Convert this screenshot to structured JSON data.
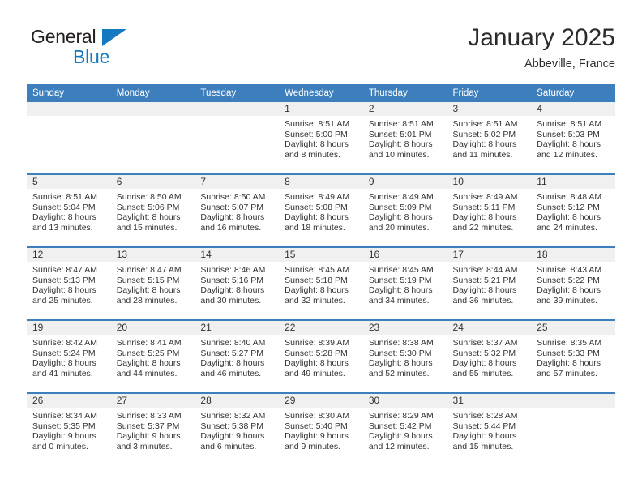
{
  "brand": {
    "name_part1": "General",
    "name_part2": "Blue"
  },
  "header": {
    "month_title": "January 2025",
    "location": "Abbeville, France"
  },
  "colors": {
    "header_blue": "#3d7ebd",
    "brand_blue": "#1579c1",
    "daynum_band": "#f0f0f0",
    "text": "#333333"
  },
  "calendar": {
    "weekday_headers": [
      "Sunday",
      "Monday",
      "Tuesday",
      "Wednesday",
      "Thursday",
      "Friday",
      "Saturday"
    ],
    "weeks": [
      [
        {
          "day": "",
          "lines": []
        },
        {
          "day": "",
          "lines": []
        },
        {
          "day": "",
          "lines": []
        },
        {
          "day": "1",
          "lines": [
            "Sunrise: 8:51 AM",
            "Sunset: 5:00 PM",
            "Daylight: 8 hours",
            "and 8 minutes."
          ]
        },
        {
          "day": "2",
          "lines": [
            "Sunrise: 8:51 AM",
            "Sunset: 5:01 PM",
            "Daylight: 8 hours",
            "and 10 minutes."
          ]
        },
        {
          "day": "3",
          "lines": [
            "Sunrise: 8:51 AM",
            "Sunset: 5:02 PM",
            "Daylight: 8 hours",
            "and 11 minutes."
          ]
        },
        {
          "day": "4",
          "lines": [
            "Sunrise: 8:51 AM",
            "Sunset: 5:03 PM",
            "Daylight: 8 hours",
            "and 12 minutes."
          ]
        }
      ],
      [
        {
          "day": "5",
          "lines": [
            "Sunrise: 8:51 AM",
            "Sunset: 5:04 PM",
            "Daylight: 8 hours",
            "and 13 minutes."
          ]
        },
        {
          "day": "6",
          "lines": [
            "Sunrise: 8:50 AM",
            "Sunset: 5:06 PM",
            "Daylight: 8 hours",
            "and 15 minutes."
          ]
        },
        {
          "day": "7",
          "lines": [
            "Sunrise: 8:50 AM",
            "Sunset: 5:07 PM",
            "Daylight: 8 hours",
            "and 16 minutes."
          ]
        },
        {
          "day": "8",
          "lines": [
            "Sunrise: 8:49 AM",
            "Sunset: 5:08 PM",
            "Daylight: 8 hours",
            "and 18 minutes."
          ]
        },
        {
          "day": "9",
          "lines": [
            "Sunrise: 8:49 AM",
            "Sunset: 5:09 PM",
            "Daylight: 8 hours",
            "and 20 minutes."
          ]
        },
        {
          "day": "10",
          "lines": [
            "Sunrise: 8:49 AM",
            "Sunset: 5:11 PM",
            "Daylight: 8 hours",
            "and 22 minutes."
          ]
        },
        {
          "day": "11",
          "lines": [
            "Sunrise: 8:48 AM",
            "Sunset: 5:12 PM",
            "Daylight: 8 hours",
            "and 24 minutes."
          ]
        }
      ],
      [
        {
          "day": "12",
          "lines": [
            "Sunrise: 8:47 AM",
            "Sunset: 5:13 PM",
            "Daylight: 8 hours",
            "and 25 minutes."
          ]
        },
        {
          "day": "13",
          "lines": [
            "Sunrise: 8:47 AM",
            "Sunset: 5:15 PM",
            "Daylight: 8 hours",
            "and 28 minutes."
          ]
        },
        {
          "day": "14",
          "lines": [
            "Sunrise: 8:46 AM",
            "Sunset: 5:16 PM",
            "Daylight: 8 hours",
            "and 30 minutes."
          ]
        },
        {
          "day": "15",
          "lines": [
            "Sunrise: 8:45 AM",
            "Sunset: 5:18 PM",
            "Daylight: 8 hours",
            "and 32 minutes."
          ]
        },
        {
          "day": "16",
          "lines": [
            "Sunrise: 8:45 AM",
            "Sunset: 5:19 PM",
            "Daylight: 8 hours",
            "and 34 minutes."
          ]
        },
        {
          "day": "17",
          "lines": [
            "Sunrise: 8:44 AM",
            "Sunset: 5:21 PM",
            "Daylight: 8 hours",
            "and 36 minutes."
          ]
        },
        {
          "day": "18",
          "lines": [
            "Sunrise: 8:43 AM",
            "Sunset: 5:22 PM",
            "Daylight: 8 hours",
            "and 39 minutes."
          ]
        }
      ],
      [
        {
          "day": "19",
          "lines": [
            "Sunrise: 8:42 AM",
            "Sunset: 5:24 PM",
            "Daylight: 8 hours",
            "and 41 minutes."
          ]
        },
        {
          "day": "20",
          "lines": [
            "Sunrise: 8:41 AM",
            "Sunset: 5:25 PM",
            "Daylight: 8 hours",
            "and 44 minutes."
          ]
        },
        {
          "day": "21",
          "lines": [
            "Sunrise: 8:40 AM",
            "Sunset: 5:27 PM",
            "Daylight: 8 hours",
            "and 46 minutes."
          ]
        },
        {
          "day": "22",
          "lines": [
            "Sunrise: 8:39 AM",
            "Sunset: 5:28 PM",
            "Daylight: 8 hours",
            "and 49 minutes."
          ]
        },
        {
          "day": "23",
          "lines": [
            "Sunrise: 8:38 AM",
            "Sunset: 5:30 PM",
            "Daylight: 8 hours",
            "and 52 minutes."
          ]
        },
        {
          "day": "24",
          "lines": [
            "Sunrise: 8:37 AM",
            "Sunset: 5:32 PM",
            "Daylight: 8 hours",
            "and 55 minutes."
          ]
        },
        {
          "day": "25",
          "lines": [
            "Sunrise: 8:35 AM",
            "Sunset: 5:33 PM",
            "Daylight: 8 hours",
            "and 57 minutes."
          ]
        }
      ],
      [
        {
          "day": "26",
          "lines": [
            "Sunrise: 8:34 AM",
            "Sunset: 5:35 PM",
            "Daylight: 9 hours",
            "and 0 minutes."
          ]
        },
        {
          "day": "27",
          "lines": [
            "Sunrise: 8:33 AM",
            "Sunset: 5:37 PM",
            "Daylight: 9 hours",
            "and 3 minutes."
          ]
        },
        {
          "day": "28",
          "lines": [
            "Sunrise: 8:32 AM",
            "Sunset: 5:38 PM",
            "Daylight: 9 hours",
            "and 6 minutes."
          ]
        },
        {
          "day": "29",
          "lines": [
            "Sunrise: 8:30 AM",
            "Sunset: 5:40 PM",
            "Daylight: 9 hours",
            "and 9 minutes."
          ]
        },
        {
          "day": "30",
          "lines": [
            "Sunrise: 8:29 AM",
            "Sunset: 5:42 PM",
            "Daylight: 9 hours",
            "and 12 minutes."
          ]
        },
        {
          "day": "31",
          "lines": [
            "Sunrise: 8:28 AM",
            "Sunset: 5:44 PM",
            "Daylight: 9 hours",
            "and 15 minutes."
          ]
        },
        {
          "day": "",
          "lines": []
        }
      ]
    ]
  }
}
